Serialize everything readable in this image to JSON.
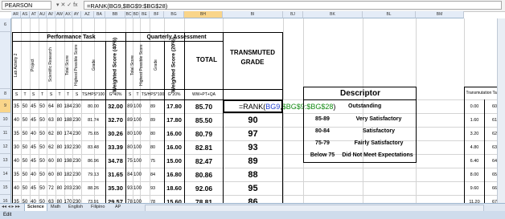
{
  "formula_bar": {
    "name_box": "PEARSON",
    "icons": "▾  ✕ ✓ fx",
    "formula": "=RANK(BG9,$BG$9:$BG$28)"
  },
  "column_headers": [
    "AR",
    "AS",
    "AT",
    "AU",
    "AV",
    "AW",
    "AX",
    "AY",
    "AZ",
    "BA",
    "BB",
    "BC",
    "BD",
    "BE",
    "BF",
    "BG",
    "BH",
    "BI",
    "BJ",
    "BK",
    "BL",
    "BM"
  ],
  "headers": {
    "performance_task": "Performance Task",
    "quarterly_assessment": "Quarterly Assessment",
    "total": "TOTAL",
    "transmuted_grade_1": "TRANSMUTED",
    "transmuted_grade_2": "GRADE",
    "lab_activity": "Lab Activity 2",
    "project": "Project",
    "scientific_research": "Scientific Research",
    "total_score": "Total Score",
    "highest_possible_score": "Highest Possible Score",
    "grade": "Grade",
    "weighted_score_pt": "Weighted Score (40%)",
    "total_score_qa": "Total Score",
    "highest_possible_score_qa": "Highest Possible Score",
    "grade_qa": "Grade",
    "weighted_score_qa": "Weighted Score (20%)",
    "row8": [
      "S",
      "T",
      "S",
      "T",
      "S",
      "T",
      "T",
      "S",
      "TS/HPS*100",
      "G*40%",
      "S",
      "T",
      "TS/HPS*100",
      "G*20%",
      "WW+PT+QA"
    ],
    "transmutation_table": "Transmutation Table"
  },
  "rows": [
    {
      "row": "9",
      "v": [
        "35",
        "50",
        "45",
        "50",
        "64",
        "80",
        "184",
        "230",
        "80.00",
        "32.00",
        "89",
        "100",
        "89",
        "17.80",
        "85.70"
      ],
      "tg": "",
      "tt": [
        "0.00",
        "60"
      ]
    },
    {
      "row": "10",
      "v": [
        "40",
        "50",
        "45",
        "50",
        "63",
        "80",
        "188",
        "230",
        "81.74",
        "32.70",
        "89",
        "100",
        "89",
        "17.80",
        "85.50"
      ],
      "tg": "90",
      "tt": [
        "1.60",
        "61"
      ]
    },
    {
      "row": "11",
      "v": [
        "35",
        "50",
        "40",
        "50",
        "62",
        "80",
        "174",
        "230",
        "75.65",
        "30.26",
        "80",
        "100",
        "80",
        "16.00",
        "80.79"
      ],
      "tg": "97",
      "tt": [
        "3.20",
        "62"
      ]
    },
    {
      "row": "12",
      "v": [
        "30",
        "50",
        "45",
        "50",
        "62",
        "80",
        "192",
        "230",
        "83.48",
        "33.39",
        "80",
        "100",
        "80",
        "16.00",
        "82.81"
      ],
      "tg": "93",
      "tt": [
        "4.80",
        "63"
      ]
    },
    {
      "row": "13",
      "v": [
        "40",
        "50",
        "45",
        "50",
        "60",
        "80",
        "198",
        "230",
        "86.96",
        "34.78",
        "75",
        "100",
        "75",
        "15.00",
        "82.47"
      ],
      "tg": "89",
      "tt": [
        "6.40",
        "64"
      ]
    },
    {
      "row": "14",
      "v": [
        "35",
        "50",
        "40",
        "50",
        "60",
        "80",
        "182",
        "230",
        "79.13",
        "31.65",
        "84",
        "100",
        "84",
        "16.80",
        "80.86"
      ],
      "tg": "88",
      "tt": [
        "8.00",
        "65"
      ]
    },
    {
      "row": "15",
      "v": [
        "40",
        "50",
        "45",
        "50",
        "72",
        "80",
        "203",
        "230",
        "88.26",
        "35.30",
        "93",
        "100",
        "93",
        "18.60",
        "92.06"
      ],
      "tg": "95",
      "tt": [
        "9.60",
        "66"
      ]
    },
    {
      "row": "16",
      "v": [
        "35",
        "50",
        "40",
        "50",
        "63",
        "80",
        "170",
        "230",
        "73.91",
        "29.57",
        "78",
        "100",
        "78",
        "15.60",
        "78.81"
      ],
      "tg": "86",
      "tt": [
        "11.20",
        "67"
      ]
    },
    {
      "row": "17",
      "v": [
        "",
        "",
        "",
        "",
        "",
        "",
        "",
        "",
        "",
        "",
        "",
        "",
        "",
        "",
        ""
      ],
      "tg": "",
      "tt": [
        "",
        ""
      ]
    }
  ],
  "rank_cell_formula": {
    "eq": "=RANK(",
    "ref1": "BG9",
    "comma": ",",
    "ref2": "$BG$9:$BG$28",
    "close": ")",
    "tail": "Outstanding"
  },
  "descriptor": {
    "title": "Descriptor",
    "rows": [
      {
        "range": "85-89",
        "label": "Very Satisfactory"
      },
      {
        "range": "80-84",
        "label": "Satisfactory"
      },
      {
        "range": "75-79",
        "label": "Fairly Satisfactory"
      },
      {
        "range": "Below 75",
        "label": "Did Not Meet Expectations"
      }
    ]
  },
  "sheet_tabs": [
    "Science",
    "Math",
    "English",
    "Filipino",
    "AP"
  ],
  "status": "Edit",
  "colors": {
    "ref_blue": "#1f3fd0",
    "ref_green": "#128a12",
    "header_bg": "#e4ecf7"
  }
}
